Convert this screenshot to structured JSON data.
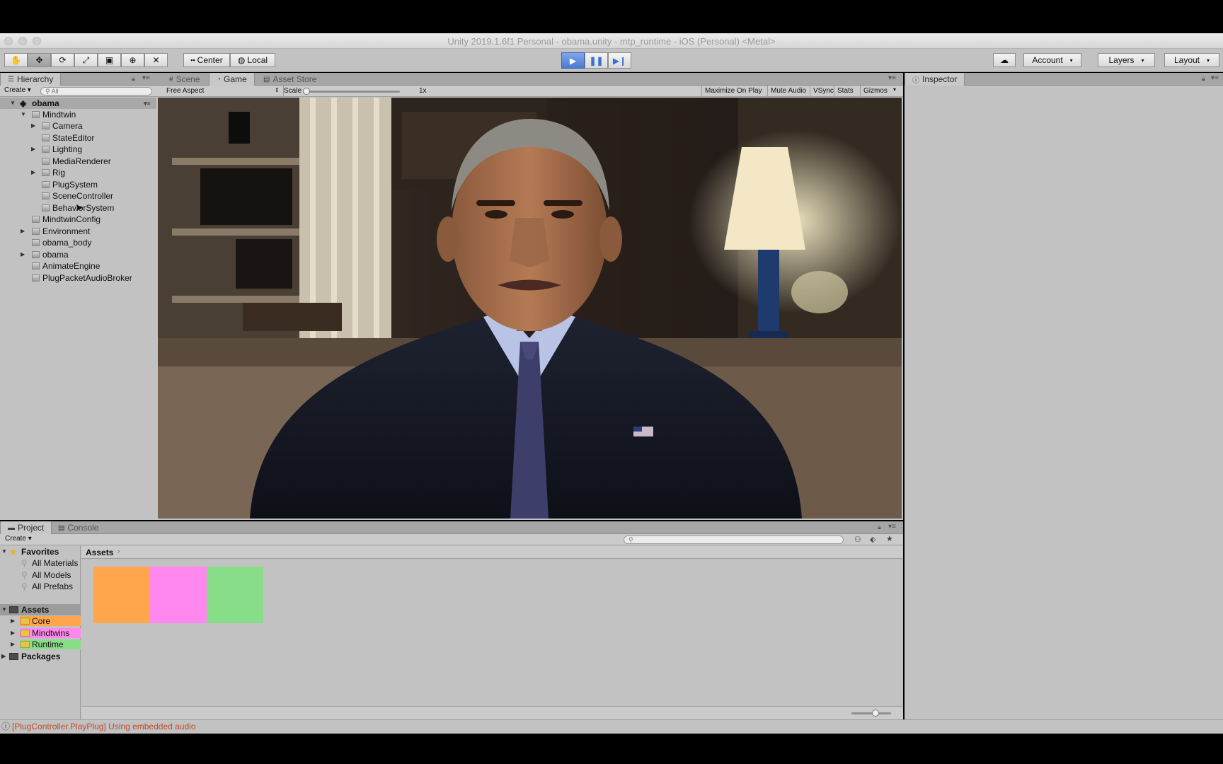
{
  "window": {
    "title": "Unity 2019.1.6f1 Personal - obama.unity - mtp_runtime - iOS (Personal) <Metal>"
  },
  "toolbar": {
    "pivot": "Center",
    "space": "Local",
    "account": "Account",
    "layers": "Layers",
    "layout": "Layout"
  },
  "hierarchy": {
    "tab": "Hierarchy",
    "create": "Create",
    "search_placeholder": "All",
    "items": [
      {
        "label": "obama"
      },
      {
        "label": "Mindtwin"
      },
      {
        "label": "Camera"
      },
      {
        "label": "StateEditor"
      },
      {
        "label": "Lighting"
      },
      {
        "label": "MediaRenderer"
      },
      {
        "label": "Rig"
      },
      {
        "label": "PlugSystem"
      },
      {
        "label": "SceneController"
      },
      {
        "label": "BehaviorSystem"
      },
      {
        "label": "MindtwinConfig"
      },
      {
        "label": "Environment"
      },
      {
        "label": "obama_body"
      },
      {
        "label": "obama"
      },
      {
        "label": "AnimateEngine"
      },
      {
        "label": "PlugPacketAudioBroker"
      }
    ]
  },
  "game": {
    "tabs": [
      "Scene",
      "Game",
      "Asset Store"
    ],
    "aspect": "Free Aspect",
    "scale_label": "Scale",
    "scale_value": "1x",
    "buttons": [
      "Maximize On Play",
      "Mute Audio",
      "VSync",
      "Stats",
      "Gizmos"
    ]
  },
  "inspector": {
    "tab": "Inspector"
  },
  "project": {
    "tabs": [
      "Project",
      "Console"
    ],
    "create": "Create",
    "favorites": {
      "label": "Favorites",
      "items": [
        "All Materials",
        "All Models",
        "All Prefabs"
      ]
    },
    "assets": {
      "label": "Assets",
      "items": [
        {
          "label": "Core",
          "color": "#FFA64D"
        },
        {
          "label": "Mindtwins",
          "color": "#FF88EE"
        },
        {
          "label": "Runtime",
          "color": "#88DD88"
        }
      ]
    },
    "packages": "Packages",
    "breadcrumb": "Assets"
  },
  "status": {
    "message": "[PlugController.PlayPlug] Using embedded audio"
  },
  "colors": {
    "play_active": "#4A7AD4",
    "panel": "#C2C2C2",
    "status_text": "#C14A2A"
  }
}
